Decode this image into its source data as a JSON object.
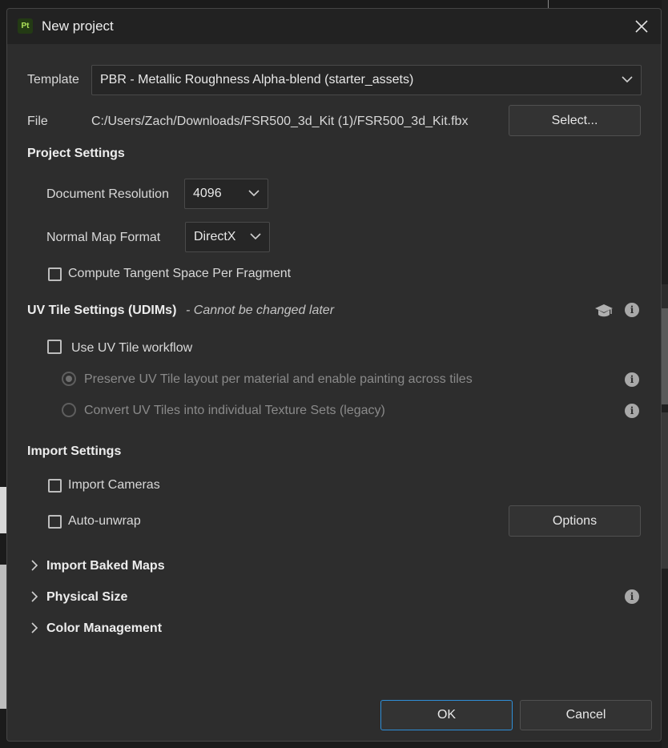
{
  "dialog": {
    "title": "New project",
    "app_icon_text": "Pt"
  },
  "template": {
    "label": "Template",
    "value": "PBR - Metallic Roughness Alpha-blend (starter_assets)"
  },
  "file": {
    "label": "File",
    "path": "C:/Users/Zach/Downloads/FSR500_3d_Kit (1)/FSR500_3d_Kit.fbx",
    "select_label": "Select..."
  },
  "project_settings": {
    "heading": "Project Settings",
    "document_resolution_label": "Document Resolution",
    "document_resolution_value": "4096",
    "normal_map_format_label": "Normal Map Format",
    "normal_map_format_value": "DirectX",
    "compute_tangent_label": "Compute Tangent Space Per Fragment",
    "compute_tangent_checked": false
  },
  "uv_tile": {
    "heading": "UV Tile Settings (UDIMs)",
    "note": "- Cannot be changed later",
    "use_workflow_label": "Use UV Tile workflow",
    "use_workflow_checked": false,
    "option_preserve": "Preserve UV Tile layout per material and enable painting across tiles",
    "option_convert": "Convert UV Tiles into individual Texture Sets (legacy)",
    "selected_option": "preserve"
  },
  "import_settings": {
    "heading": "Import Settings",
    "import_cameras_label": "Import Cameras",
    "import_cameras_checked": false,
    "auto_unwrap_label": "Auto-unwrap",
    "auto_unwrap_checked": false,
    "options_label": "Options"
  },
  "collapsible": {
    "baked_maps": "Import Baked Maps",
    "physical_size": "Physical Size",
    "color_management": "Color Management"
  },
  "footer": {
    "ok_label": "OK",
    "cancel_label": "Cancel"
  },
  "icons": {
    "info": "info-icon",
    "academy": "graduation-cap-icon",
    "close": "close-icon",
    "chevron": "chevron-down-icon"
  },
  "colors": {
    "dialog_bg": "#2d2d2d",
    "titlebar_bg": "#222222",
    "primary_border": "#2f8fd8",
    "app_icon_green": "#aee35a"
  }
}
